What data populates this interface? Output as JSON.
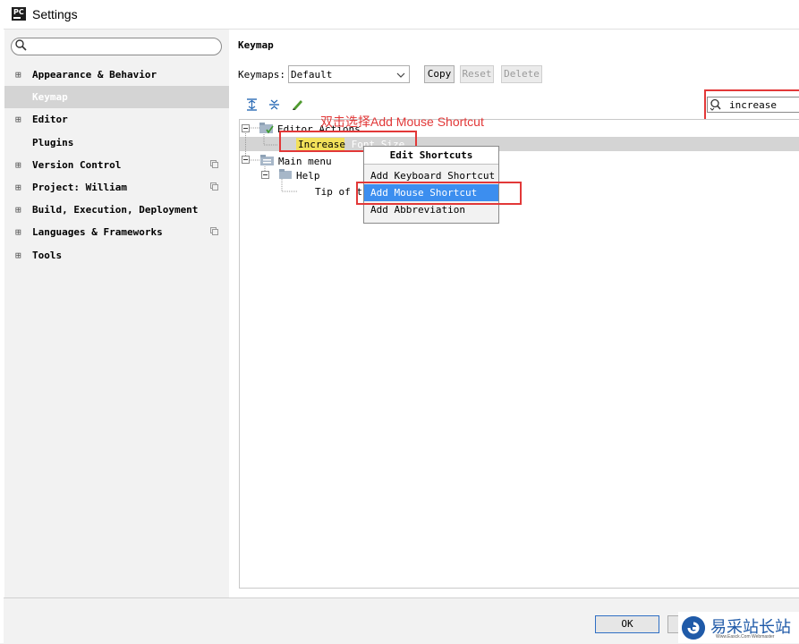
{
  "window": {
    "title": "Settings",
    "icon": "pycharm-icon"
  },
  "sidebar": {
    "search_placeholder": "",
    "items": [
      {
        "label": "Appearance & Behavior",
        "expandable": true,
        "project_icon": false,
        "selected": false
      },
      {
        "label": "Keymap",
        "expandable": false,
        "project_icon": false,
        "selected": true
      },
      {
        "label": "Editor",
        "expandable": true,
        "project_icon": false,
        "selected": false
      },
      {
        "label": "Plugins",
        "expandable": false,
        "project_icon": false,
        "selected": false
      },
      {
        "label": "Version Control",
        "expandable": true,
        "project_icon": true,
        "selected": false
      },
      {
        "label": "Project: William",
        "expandable": true,
        "project_icon": true,
        "selected": false
      },
      {
        "label": "Build, Execution, Deployment",
        "expandable": true,
        "project_icon": false,
        "selected": false
      },
      {
        "label": "Languages & Frameworks",
        "expandable": true,
        "project_icon": true,
        "selected": false
      },
      {
        "label": "Tools",
        "expandable": true,
        "project_icon": false,
        "selected": false
      }
    ],
    "expand_glyph": "⊞"
  },
  "content": {
    "title": "Keymap",
    "keymaps_label": "Keymaps:",
    "keymap_value": "Default",
    "copy_label": "Copy",
    "reset_label": "Reset",
    "delete_label": "Delete",
    "filter_value": "increase"
  },
  "tree": {
    "editor_actions": "Editor Actions",
    "increase_match": "Increase",
    "increase_rest": " Font Size",
    "main_menu": "Main menu",
    "help": "Help",
    "tip_of_the": "Tip of th"
  },
  "annotation": "双击选择Add Mouse Shortcut",
  "popup": {
    "title": "Edit Shortcuts",
    "items": [
      "Add Keyboard Shortcut",
      "Add Mouse Shortcut",
      "Add Abbreviation"
    ],
    "active_index": 1
  },
  "footer": {
    "ok_label": "OK",
    "cancel_label": ""
  },
  "watermark": {
    "text": "易采站长站",
    "sub": "Www.Easck.Com  Webmaster"
  },
  "colors": {
    "highlight_red": "#e23838",
    "menu_active": "#3c8eef",
    "search_match": "#f2e05a",
    "sidebar_bg": "#f2f2f2"
  }
}
